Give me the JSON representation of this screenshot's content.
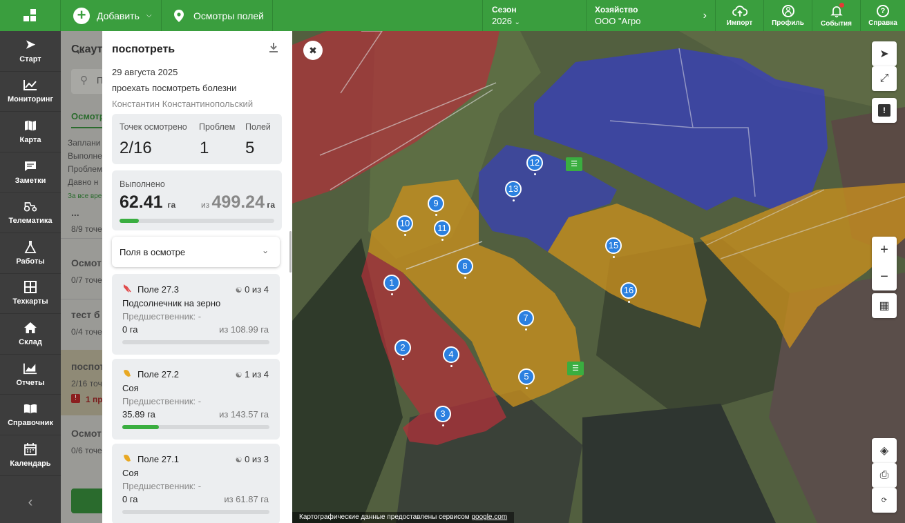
{
  "topbar": {
    "add_label": "Добавить",
    "inspections_label": "Осмотры полей",
    "season_key": "Сезон",
    "season_value": "2026",
    "farm_key": "Хозяйство",
    "farm_value": "ООО \"Агро",
    "buttons": [
      {
        "label": "Импорт",
        "icon": "cloud-upload-icon"
      },
      {
        "label": "Профиль",
        "icon": "profile-icon"
      },
      {
        "label": "События",
        "icon": "bell-icon"
      },
      {
        "label": "Справка",
        "icon": "help-icon"
      }
    ]
  },
  "nav": {
    "items": [
      {
        "label": "Старт",
        "icon": "rocket-icon"
      },
      {
        "label": "Мониторинг",
        "icon": "chart-icon"
      },
      {
        "label": "Карта",
        "icon": "map-icon"
      },
      {
        "label": "Заметки",
        "icon": "note-icon"
      },
      {
        "label": "Телематика",
        "icon": "tractor-icon"
      },
      {
        "label": "Работы",
        "icon": "works-icon"
      },
      {
        "label": "Техкарты",
        "icon": "grid-icon"
      },
      {
        "label": "Склад",
        "icon": "home-icon"
      },
      {
        "label": "Отчеты",
        "icon": "reports-icon"
      },
      {
        "label": "Справочник",
        "icon": "book-icon"
      },
      {
        "label": "Календарь",
        "icon": "calendar-icon"
      }
    ]
  },
  "scoutlist": {
    "title": "Скаут",
    "search": "П",
    "tab": "Осмотр",
    "filters": [
      "Заплани",
      "Выполне",
      "Проблем",
      "Давно н"
    ],
    "all_link": "За все вре",
    "items": [
      {
        "title": "...",
        "meta": "8/9 точе"
      },
      {
        "title": "Осмот",
        "meta": "0/7 точе"
      },
      {
        "title": "тест б",
        "meta": "0/4 точе"
      },
      {
        "title": "поспот",
        "meta": "2/16 точ",
        "problem": "1 пр"
      },
      {
        "title": "Осмот",
        "meta": "0/6 точе"
      }
    ]
  },
  "panel": {
    "title": "поспотреть",
    "date": "29 августа 2025",
    "description": "проехать посмотреть болезни",
    "author": "Константин Константинопольский",
    "stats": {
      "points_label": "Точек осмотрено",
      "points_value": "2/16",
      "problems_label": "Проблем",
      "problems_value": "1",
      "fields_label": "Полей",
      "fields_value": "5"
    },
    "done": {
      "label": "Выполнено",
      "value": "62.41",
      "unit": "га",
      "of_label": "из",
      "total": "499.24",
      "total_unit": "га",
      "fraction": 0.125
    },
    "fields_dropdown": "Поля в осмотре",
    "fields": [
      {
        "name": "Поле 27.3",
        "icon": "sunflower-icon",
        "count": "0 из 4",
        "crop": "Подсолнечник на зерно",
        "predecessor": "Предшественник: -",
        "done": "0 га",
        "total": "из 108.99 га",
        "fraction": 0
      },
      {
        "name": "Поле 27.2",
        "icon": "soy-icon",
        "count": "1 из 4",
        "crop": "Соя",
        "predecessor": "Предшественник: -",
        "done": "35.89 га",
        "total": "из 143.57 га",
        "fraction": 0.25
      },
      {
        "name": "Поле 27.1",
        "icon": "soy-icon",
        "count": "0 из 3",
        "crop": "Соя",
        "predecessor": "Предшественник: -",
        "done": "0 га",
        "total": "из 61.87 га",
        "fraction": 0
      }
    ]
  },
  "map": {
    "pins": [
      "1",
      "2",
      "3",
      "4",
      "5",
      "7",
      "8",
      "9",
      "10",
      "11",
      "12",
      "13",
      "15",
      "16"
    ],
    "attribution_prefix": "Картографические данные предоставлены сервисом ",
    "attribution_link": "google.com",
    "colors": {
      "red": "#b0323a",
      "yellow": "#c9901e",
      "blue": "#3840b8"
    }
  }
}
